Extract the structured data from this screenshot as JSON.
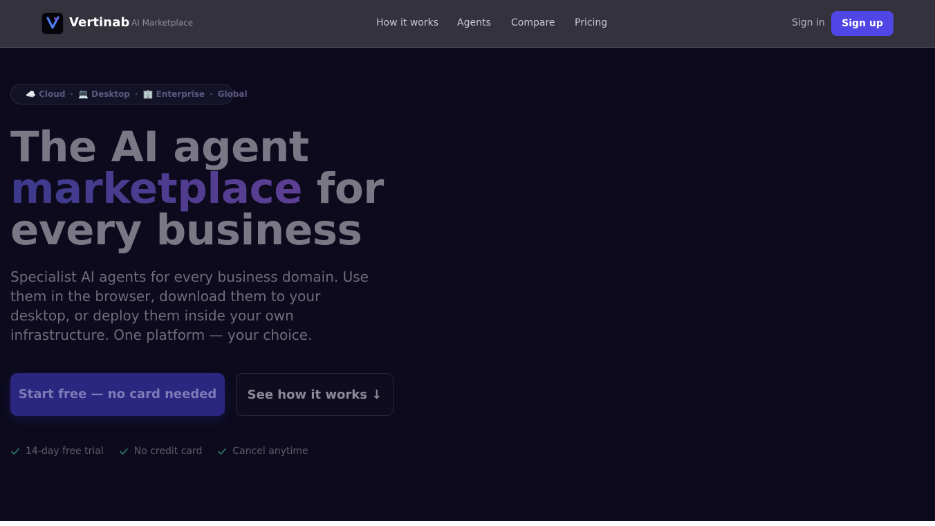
{
  "header": {
    "brand": "Vertinab",
    "brand_sub": "AI Marketplace",
    "logo_text": "VERTINAB",
    "nav": [
      {
        "label": "How it works",
        "x": 0
      },
      {
        "label": "Agents"
      },
      {
        "label": "Compare"
      },
      {
        "label": "Pricing"
      }
    ],
    "sign_in": "Sign in",
    "sign_up": "Sign up"
  },
  "hero": {
    "badge": {
      "items": [
        "☁️ Cloud",
        "💻 Desktop",
        "🏢 Enterprise",
        "Global"
      ],
      "separator": "·"
    },
    "headline": {
      "line1": "The AI agent",
      "highlight": "marketplace",
      "line2_rest": " for",
      "line3": "every business"
    },
    "subtext": "Specialist AI agents for every business domain. Use them in the browser, download them to your desktop, or deploy them inside your own infrastructure. One platform — your choice.",
    "primary_cta": "Start free — no card needed",
    "secondary_cta": "See how it works ↓",
    "checks": [
      "14-day free trial",
      "No credit card",
      "Cancel anytime"
    ]
  },
  "colors": {
    "accent": "#4f46e5",
    "page_bg": "#0c0a1c",
    "header_bg": "#33323d",
    "check": "#2f7f6a"
  }
}
